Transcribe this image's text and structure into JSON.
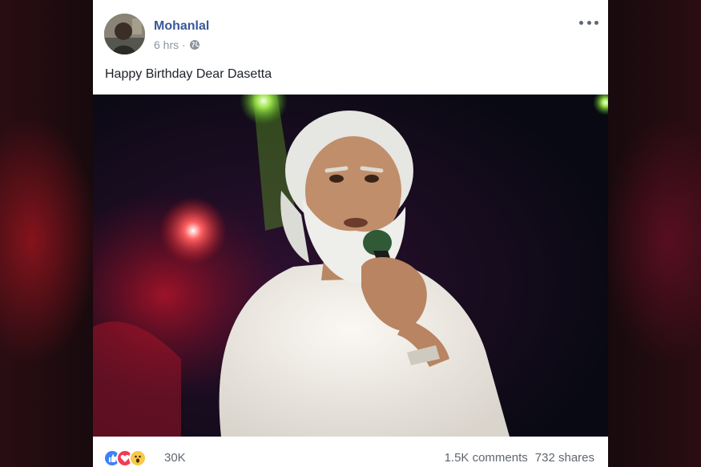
{
  "post": {
    "author": "Mohanlal",
    "time": "6 hrs",
    "separator": "·",
    "text": "Happy Birthday Dear Dasetta",
    "privacy_icon": "globe-icon",
    "menu_icon": "more-options-icon"
  },
  "footer": {
    "reaction_icons": [
      "like-icon",
      "love-icon",
      "wow-icon"
    ],
    "reaction_count": "30K",
    "comments": "1.5K comments",
    "shares": "732 shares"
  },
  "colors": {
    "author": "#385898",
    "meta": "#8d949e",
    "like": "#3b82f6",
    "love": "#f23b56",
    "wow": "#f7c948"
  }
}
